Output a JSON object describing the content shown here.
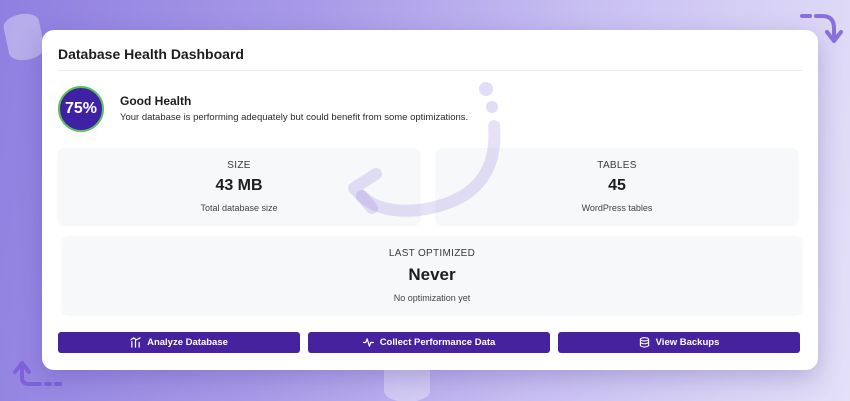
{
  "dashboard": {
    "title": "Database Health Dashboard"
  },
  "health": {
    "score_label": "75%",
    "score": 75,
    "status": "Good Health",
    "description": "Your database is performing adequately but could benefit from some optimizations.",
    "ring_color": "#3f22a3",
    "ring_border_color": "#5ec05e"
  },
  "stats": {
    "size": {
      "label": "SIZE",
      "value": "43 MB",
      "sub": "Total database size"
    },
    "tables": {
      "label": "TABLES",
      "value": "45",
      "sub": "WordPress tables"
    },
    "last_optimized": {
      "label": "LAST OPTIMIZED",
      "value": "Never",
      "sub": "No optimization yet"
    }
  },
  "actions": {
    "analyze": {
      "label": "Analyze Database",
      "icon": "bar-chart-icon"
    },
    "performance": {
      "label": "Collect Performance Data",
      "icon": "activity-icon"
    },
    "backups": {
      "label": "View Backups",
      "icon": "database-icon"
    }
  },
  "colors": {
    "button_bg": "#47229e",
    "accent": "#3f22a3"
  }
}
